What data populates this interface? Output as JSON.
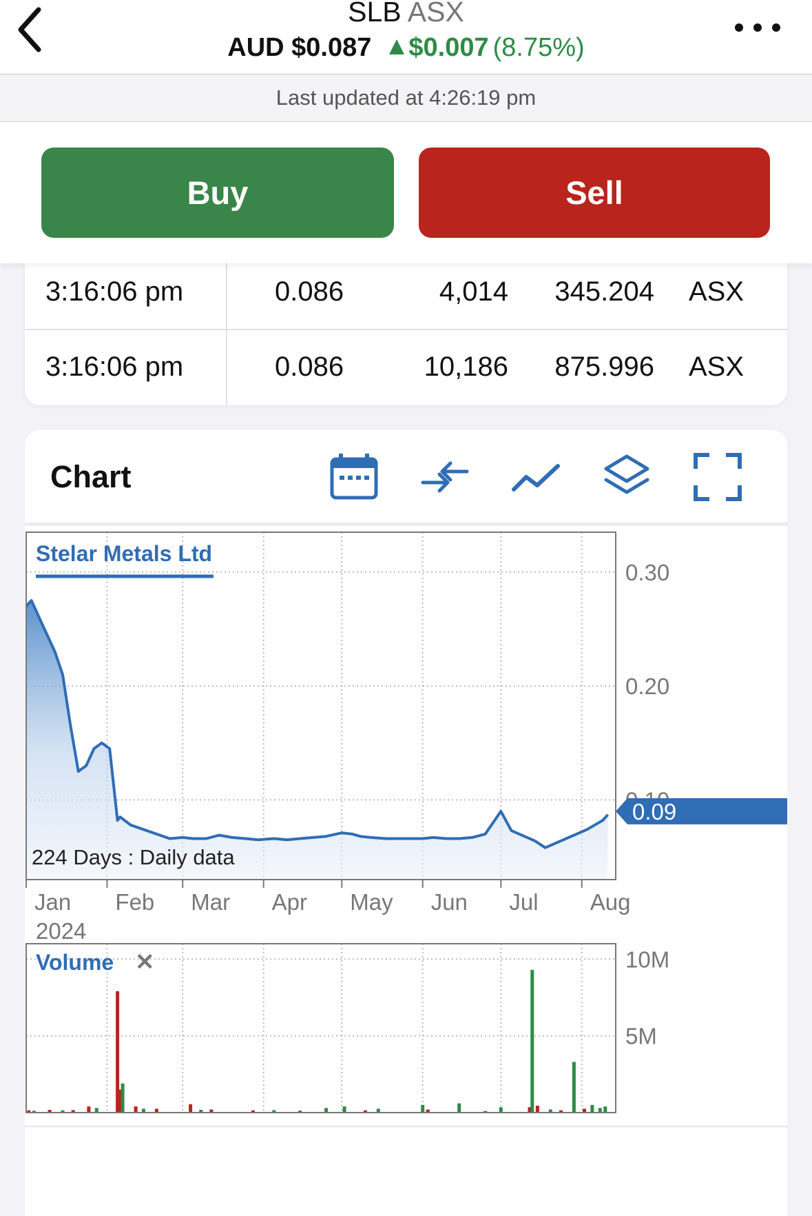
{
  "header": {
    "symbol": "SLB",
    "exchange": "ASX",
    "price": "AUD $0.087",
    "change": "$0.007",
    "change_pct": "(8.75%)",
    "last_updated": "Last updated at 4:26:19 pm"
  },
  "actions": {
    "buy_label": "Buy",
    "sell_label": "Sell"
  },
  "trades": [
    {
      "time": "3:16:06 pm",
      "price": "0.086",
      "volume": "4,014",
      "value": "345.204",
      "market": "ASX"
    },
    {
      "time": "3:16:06 pm",
      "price": "0.086",
      "volume": "10,186",
      "value": "875.996",
      "market": "ASX"
    }
  ],
  "chart_section": {
    "title": "Chart",
    "tools": [
      "calendar-icon",
      "compare-icon",
      "line-type-icon",
      "layers-icon",
      "fullscreen-icon"
    ]
  },
  "colors": {
    "up": "#2e8b47",
    "down": "#b9241d",
    "line": "#2f6db5",
    "buy": "#3a8549",
    "sell": "#b9241d"
  },
  "chart_data": [
    {
      "type": "area",
      "title": "Stelar Metals Ltd",
      "footer": "224 Days : Daily data",
      "x_tick_labels": [
        "Jan",
        "Feb",
        "Mar",
        "Apr",
        "May",
        "Jun",
        "Jul",
        "Aug"
      ],
      "x_year_label": "2024",
      "y_tick_labels": [
        "0.30",
        "0.20",
        "0.10"
      ],
      "y_ticks": [
        0.3,
        0.2,
        0.1
      ],
      "ylim": [
        0.03,
        0.335
      ],
      "last_value_label": "0.09",
      "last_value": 0.09,
      "grid": true,
      "x": [
        "2024-01-01",
        "2024-01-03",
        "2024-01-06",
        "2024-01-09",
        "2024-01-12",
        "2024-01-15",
        "2024-01-18",
        "2024-01-21",
        "2024-01-24",
        "2024-01-27",
        "2024-01-30",
        "2024-02-02",
        "2024-02-05",
        "2024-02-06",
        "2024-02-10",
        "2024-02-15",
        "2024-02-20",
        "2024-02-25",
        "2024-03-01",
        "2024-03-05",
        "2024-03-10",
        "2024-03-15",
        "2024-03-20",
        "2024-03-25",
        "2024-03-30",
        "2024-04-05",
        "2024-04-10",
        "2024-04-15",
        "2024-04-20",
        "2024-04-25",
        "2024-05-01",
        "2024-05-05",
        "2024-05-08",
        "2024-05-12",
        "2024-05-18",
        "2024-05-25",
        "2024-06-01",
        "2024-06-05",
        "2024-06-10",
        "2024-06-15",
        "2024-06-20",
        "2024-06-25",
        "2024-07-01",
        "2024-07-05",
        "2024-07-10",
        "2024-07-14",
        "2024-07-18",
        "2024-07-22",
        "2024-07-26",
        "2024-07-30",
        "2024-08-03",
        "2024-08-06",
        "2024-08-09",
        "2024-08-11"
      ],
      "series": [
        {
          "values": [
            0.27,
            0.275,
            0.26,
            0.245,
            0.23,
            0.21,
            0.165,
            0.125,
            0.13,
            0.145,
            0.15,
            0.145,
            0.082,
            0.085,
            0.078,
            0.074,
            0.07,
            0.066,
            0.067,
            0.066,
            0.066,
            0.069,
            0.067,
            0.066,
            0.065,
            0.066,
            0.065,
            0.066,
            0.067,
            0.068,
            0.071,
            0.07,
            0.068,
            0.067,
            0.066,
            0.066,
            0.066,
            0.067,
            0.066,
            0.066,
            0.067,
            0.07,
            0.09,
            0.073,
            0.068,
            0.064,
            0.058,
            0.062,
            0.066,
            0.07,
            0.074,
            0.078,
            0.082,
            0.087
          ]
        }
      ]
    },
    {
      "type": "bar",
      "title": "Volume",
      "close_label": "✕",
      "y_tick_labels": [
        "10M",
        "5M"
      ],
      "y_ticks": [
        10000000,
        5000000
      ],
      "ylim": [
        0,
        11000000
      ],
      "series": [
        {
          "name": "down",
          "x": [
            "2024-01-02",
            "2024-01-10",
            "2024-01-19",
            "2024-01-25",
            "2024-02-05",
            "2024-02-06",
            "2024-02-12",
            "2024-02-20",
            "2024-03-04",
            "2024-03-12",
            "2024-03-28",
            "2024-04-15",
            "2024-05-10",
            "2024-06-03",
            "2024-06-25",
            "2024-07-12",
            "2024-07-15",
            "2024-07-24",
            "2024-08-02"
          ],
          "values": [
            150000,
            180000,
            160000,
            400000,
            7900000,
            1500000,
            400000,
            250000,
            550000,
            200000,
            150000,
            120000,
            150000,
            200000,
            100000,
            350000,
            450000,
            150000,
            250000
          ]
        },
        {
          "name": "up",
          "x": [
            "2024-01-04",
            "2024-01-15",
            "2024-01-28",
            "2024-02-07",
            "2024-02-15",
            "2024-03-08",
            "2024-04-05",
            "2024-04-25",
            "2024-05-02",
            "2024-05-15",
            "2024-06-01",
            "2024-06-15",
            "2024-07-01",
            "2024-07-13",
            "2024-07-20",
            "2024-07-29",
            "2024-08-05",
            "2024-08-08",
            "2024-08-10"
          ],
          "values": [
            120000,
            150000,
            300000,
            1900000,
            250000,
            180000,
            160000,
            300000,
            400000,
            250000,
            500000,
            600000,
            350000,
            9300000,
            200000,
            3300000,
            500000,
            300000,
            400000
          ]
        }
      ]
    }
  ]
}
